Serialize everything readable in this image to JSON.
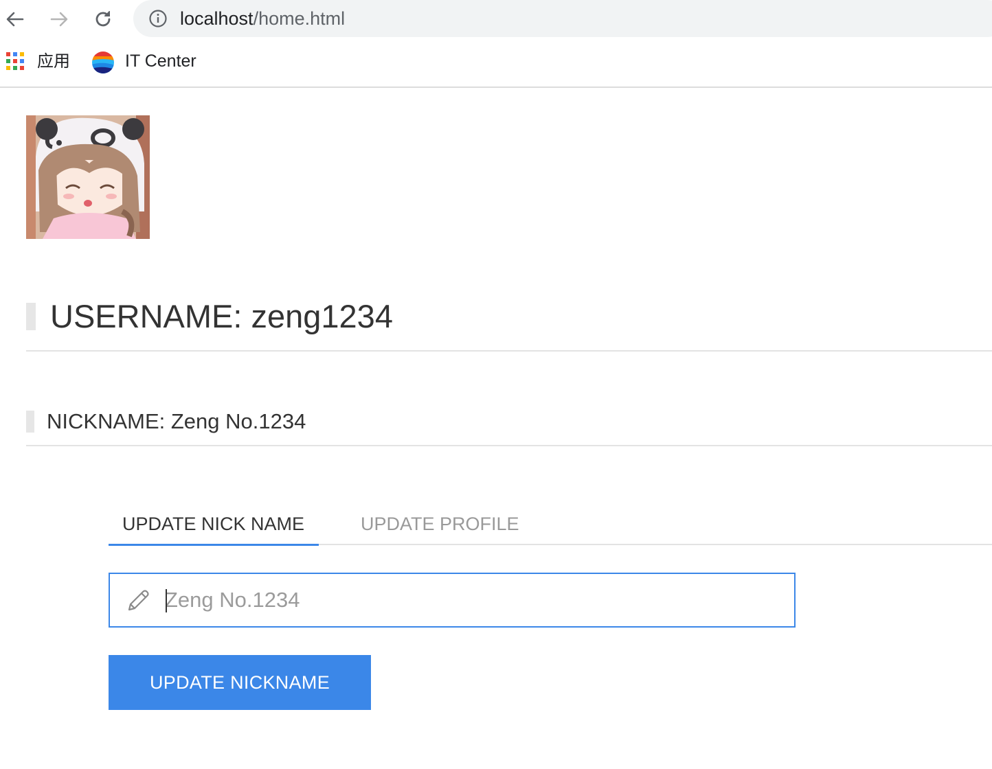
{
  "browser": {
    "url_host": "localhost",
    "url_path": "/home.html",
    "bookmarks": [
      {
        "label": "应用",
        "icon": "apps-grid-icon"
      },
      {
        "label": "IT Center",
        "icon": "it-center-logo-icon"
      }
    ]
  },
  "profile": {
    "avatar_icon": "avatar-anime-girl-panda-hood",
    "username_line": "USERNAME: zeng1234",
    "nickname_line": "NICKNAME: Zeng No.1234"
  },
  "tabs": [
    {
      "label": "UPDATE NICK NAME",
      "active": true
    },
    {
      "label": "UPDATE PROFILE",
      "active": false
    }
  ],
  "form": {
    "nickname_placeholder": "Zeng No.1234",
    "submit_label": "UPDATE NICKNAME"
  },
  "colors": {
    "accent": "#3b87e8",
    "heading_bar": "#e6e6e6",
    "text": "#333333"
  }
}
